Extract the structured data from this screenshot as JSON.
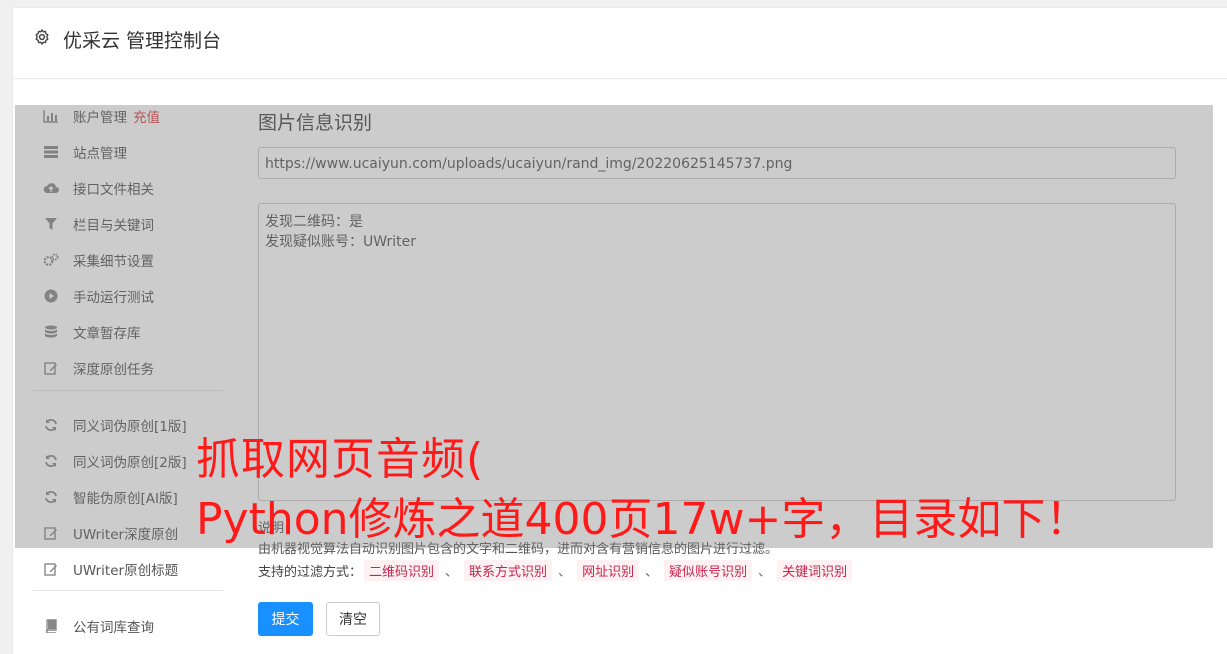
{
  "header": {
    "title": "优采云 管理控制台",
    "icon": "gear-icon"
  },
  "sidebar": {
    "items": [
      {
        "label": "账户管理",
        "extra": "充值",
        "icon": "bar-chart-icon"
      },
      {
        "label": "站点管理",
        "icon": "server-icon"
      },
      {
        "label": "接口文件相关",
        "icon": "cloud-upload-icon"
      },
      {
        "label": "栏目与关键词",
        "icon": "filter-icon"
      },
      {
        "label": "采集细节设置",
        "icon": "cogs-icon"
      },
      {
        "label": "手动运行测试",
        "icon": "play-circle-icon"
      },
      {
        "label": "文章暂存库",
        "icon": "database-icon"
      },
      {
        "label": "深度原创任务",
        "icon": "edit-icon"
      },
      {
        "label": "同义词伪原创[1版]",
        "icon": "refresh-icon"
      },
      {
        "label": "同义词伪原创[2版]",
        "icon": "refresh-icon"
      },
      {
        "label": "智能伪原创[AI版]",
        "icon": "refresh-icon"
      },
      {
        "label": "UWriter深度原创",
        "icon": "edit-icon"
      },
      {
        "label": "UWriter原创标题",
        "icon": "edit-icon"
      },
      {
        "label": "公有词库查询",
        "icon": "book-icon"
      }
    ]
  },
  "main": {
    "section_title": "图片信息识别",
    "url_value": "https://www.ucaiyun.com/uploads/ucaiyun/rand_img/20220625145737.png",
    "result_lines": [
      "发现二维码：是",
      "发现疑似账号：UWriter"
    ],
    "note_label": "说明：",
    "note_text": "由机器视觉算法自动识别图片包含的文字和二维码，进而对含有营销信息的图片进行过滤。",
    "filter_label": "支持的过滤方式：",
    "filters": [
      "二维码识别",
      "联系方式识别",
      "网址识别",
      "疑似账号识别",
      "关键词识别"
    ],
    "separator": "、",
    "submit_label": "提交",
    "clear_label": "清空"
  },
  "watermark": {
    "line1": "抓取网页音频(",
    "line2": "Python修炼之道400页17w+字，目录如下！"
  },
  "colors": {
    "primary": "#1890ff",
    "highlight_red": "#e04040",
    "tag_text": "#c7254e",
    "watermark": "#ff1a1a"
  }
}
